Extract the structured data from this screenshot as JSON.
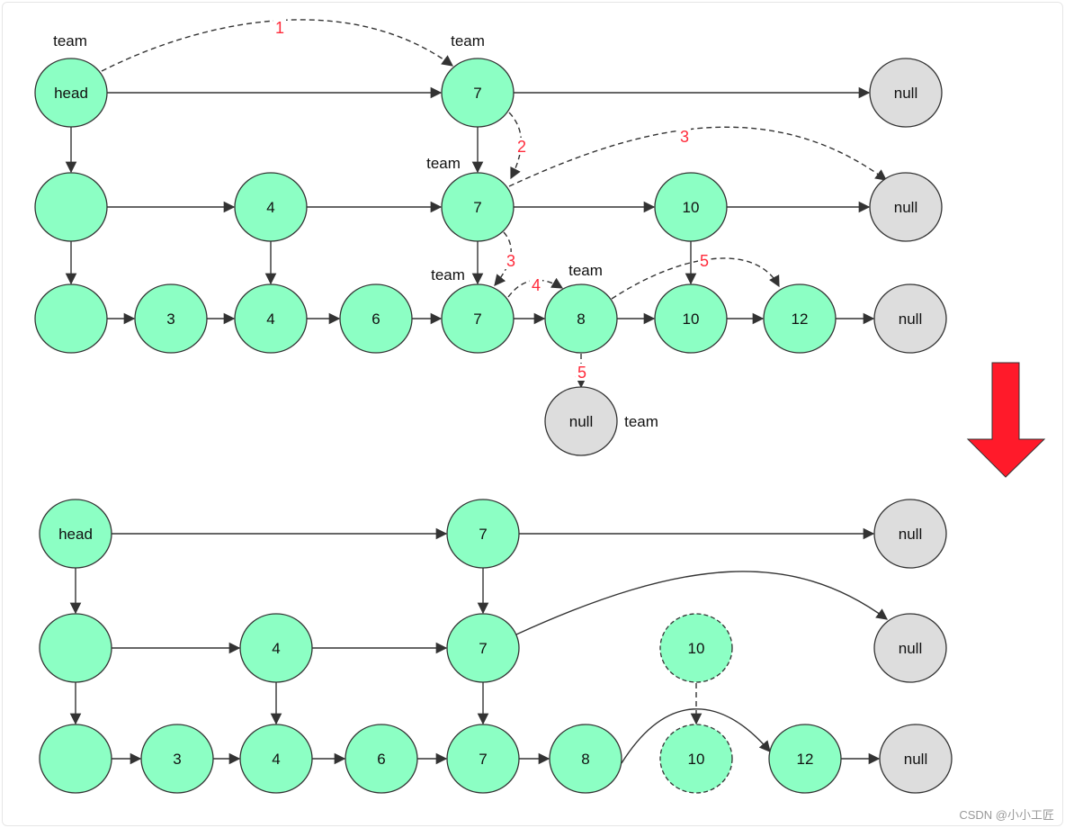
{
  "colors": {
    "node_fill": "#8cffc4",
    "null_fill": "#dddddd",
    "stroke": "#333333",
    "step_label": "#ff2a3a",
    "big_arrow": "#ff1a2a"
  },
  "top": {
    "nodes": [
      {
        "id": "t-head",
        "label": "head",
        "kind": "node"
      },
      {
        "id": "t-r1-7",
        "label": "7",
        "kind": "node"
      },
      {
        "id": "t-r1-null",
        "label": "null",
        "kind": "null"
      },
      {
        "id": "t-r2-h",
        "label": "",
        "kind": "node"
      },
      {
        "id": "t-r2-4",
        "label": "4",
        "kind": "node"
      },
      {
        "id": "t-r2-7",
        "label": "7",
        "kind": "node"
      },
      {
        "id": "t-r2-10",
        "label": "10",
        "kind": "node"
      },
      {
        "id": "t-r2-null",
        "label": "null",
        "kind": "null"
      },
      {
        "id": "t-r3-h",
        "label": "",
        "kind": "node"
      },
      {
        "id": "t-r3-3",
        "label": "3",
        "kind": "node"
      },
      {
        "id": "t-r3-4",
        "label": "4",
        "kind": "node"
      },
      {
        "id": "t-r3-6",
        "label": "6",
        "kind": "node"
      },
      {
        "id": "t-r3-7",
        "label": "7",
        "kind": "node"
      },
      {
        "id": "t-r3-8",
        "label": "8",
        "kind": "node"
      },
      {
        "id": "t-r3-10",
        "label": "10",
        "kind": "node"
      },
      {
        "id": "t-r3-12",
        "label": "12",
        "kind": "node"
      },
      {
        "id": "t-r3-null",
        "label": "null",
        "kind": "null"
      },
      {
        "id": "t-down-null",
        "label": "null",
        "kind": "null"
      }
    ],
    "edges": [
      [
        "t-head",
        "t-r1-7"
      ],
      [
        "t-r1-7",
        "t-r1-null"
      ],
      [
        "t-head",
        "t-r2-h"
      ],
      [
        "t-r1-7",
        "t-r2-7"
      ],
      [
        "t-r2-h",
        "t-r2-4"
      ],
      [
        "t-r2-4",
        "t-r2-7"
      ],
      [
        "t-r2-7",
        "t-r2-10"
      ],
      [
        "t-r2-10",
        "t-r2-null"
      ],
      [
        "t-r2-h",
        "t-r3-h"
      ],
      [
        "t-r2-4",
        "t-r3-4"
      ],
      [
        "t-r2-7",
        "t-r3-7"
      ],
      [
        "t-r2-10",
        "t-r3-10"
      ],
      [
        "t-r3-h",
        "t-r3-3"
      ],
      [
        "t-r3-3",
        "t-r3-4"
      ],
      [
        "t-r3-4",
        "t-r3-6"
      ],
      [
        "t-r3-6",
        "t-r3-7"
      ],
      [
        "t-r3-7",
        "t-r3-8"
      ],
      [
        "t-r3-8",
        "t-r3-10"
      ],
      [
        "t-r3-10",
        "t-r3-12"
      ],
      [
        "t-r3-12",
        "t-r3-null"
      ]
    ],
    "team_labels": [
      "team",
      "team",
      "team",
      "team",
      "team",
      "team"
    ],
    "steps": [
      "1",
      "2",
      "3",
      "3",
      "4",
      "5",
      "5"
    ]
  },
  "bottom": {
    "nodes": [
      {
        "id": "b-head",
        "label": "head",
        "kind": "node"
      },
      {
        "id": "b-r1-7",
        "label": "7",
        "kind": "node"
      },
      {
        "id": "b-r1-null",
        "label": "null",
        "kind": "null"
      },
      {
        "id": "b-r2-h",
        "label": "",
        "kind": "node"
      },
      {
        "id": "b-r2-4",
        "label": "4",
        "kind": "node"
      },
      {
        "id": "b-r2-7",
        "label": "7",
        "kind": "node"
      },
      {
        "id": "b-r2-10",
        "label": "10",
        "kind": "removed"
      },
      {
        "id": "b-r2-null",
        "label": "null",
        "kind": "null"
      },
      {
        "id": "b-r3-h",
        "label": "",
        "kind": "node"
      },
      {
        "id": "b-r3-3",
        "label": "3",
        "kind": "node"
      },
      {
        "id": "b-r3-4",
        "label": "4",
        "kind": "node"
      },
      {
        "id": "b-r3-6",
        "label": "6",
        "kind": "node"
      },
      {
        "id": "b-r3-7",
        "label": "7",
        "kind": "node"
      },
      {
        "id": "b-r3-8",
        "label": "8",
        "kind": "node"
      },
      {
        "id": "b-r3-10",
        "label": "10",
        "kind": "removed"
      },
      {
        "id": "b-r3-12",
        "label": "12",
        "kind": "node"
      },
      {
        "id": "b-r3-null",
        "label": "null",
        "kind": "null"
      }
    ],
    "edges": [
      [
        "b-head",
        "b-r1-7"
      ],
      [
        "b-r1-7",
        "b-r1-null"
      ],
      [
        "b-head",
        "b-r2-h"
      ],
      [
        "b-r1-7",
        "b-r2-7"
      ],
      [
        "b-r2-h",
        "b-r2-4"
      ],
      [
        "b-r2-4",
        "b-r2-7"
      ],
      [
        "b-r2-h",
        "b-r3-h"
      ],
      [
        "b-r2-4",
        "b-r3-4"
      ],
      [
        "b-r2-7",
        "b-r3-7"
      ],
      [
        "b-r3-h",
        "b-r3-3"
      ],
      [
        "b-r3-3",
        "b-r3-4"
      ],
      [
        "b-r3-4",
        "b-r3-6"
      ],
      [
        "b-r3-6",
        "b-r3-7"
      ],
      [
        "b-r3-7",
        "b-r3-8"
      ],
      [
        "b-r3-12",
        "b-r3-null"
      ]
    ]
  },
  "watermark": "CSDN @小小工匠"
}
